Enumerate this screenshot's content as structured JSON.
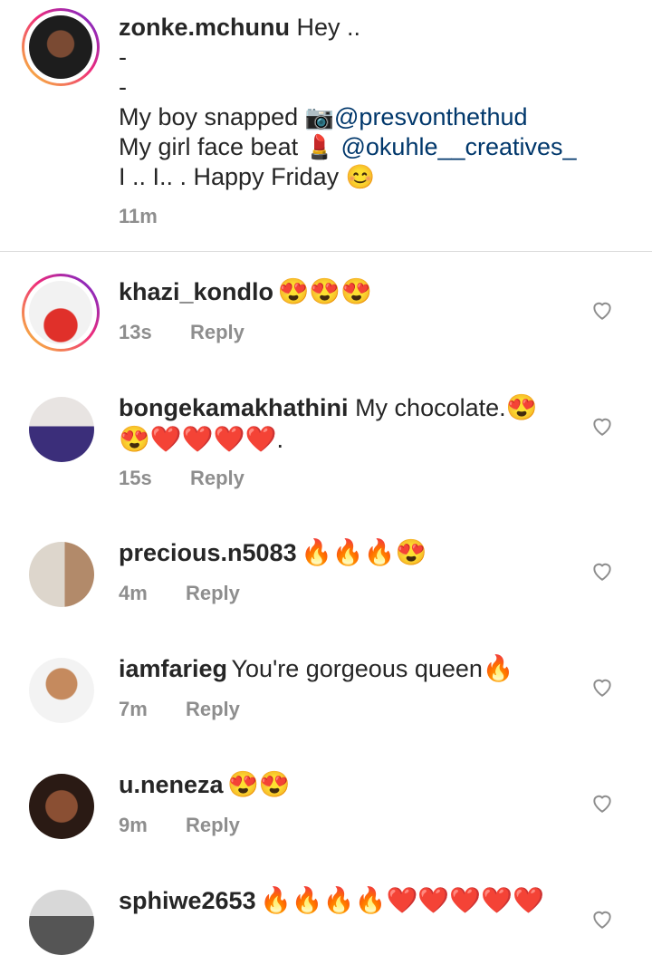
{
  "post": {
    "username": "zonke.mchunu",
    "text_line1": "Hey ..",
    "dash1": "-",
    "dash2": "-",
    "line_boy_prefix": "My boy snapped",
    "mention_photographer": "@presvonthethud",
    "line_girl_prefix": "My girl face beat",
    "mention_mua": "@okuhle__creatives_",
    "line_final": "I .. I.. . Happy Friday",
    "time": "11m"
  },
  "comments": [
    {
      "username": "khazi_kondlo",
      "text": "",
      "emojis": "😍😍😍",
      "time": "13s",
      "reply": "Reply"
    },
    {
      "username": "bongekamakhathini",
      "text": "My chocolate.",
      "emojis": "😍",
      "emojis_line2": "😍❤️❤️❤️❤️.",
      "time": "15s",
      "reply": "Reply"
    },
    {
      "username": "precious.n5083",
      "text": "",
      "emojis": "🔥🔥🔥😍",
      "time": "4m",
      "reply": "Reply"
    },
    {
      "username": "iamfarieg",
      "text": "You're gorgeous queen",
      "emojis": "🔥",
      "time": "7m",
      "reply": "Reply"
    },
    {
      "username": "u.neneza",
      "text": "",
      "emojis": "😍😍",
      "time": "9m",
      "reply": "Reply"
    },
    {
      "username": "sphiwe2653",
      "text": "",
      "emojis": "🔥🔥🔥🔥❤️❤️❤️❤️❤️",
      "time": "",
      "reply": ""
    }
  ],
  "colors": {
    "text": "#262626",
    "meta": "#8e8e8e",
    "mention": "#00376b",
    "divider": "#dbdbdb"
  }
}
